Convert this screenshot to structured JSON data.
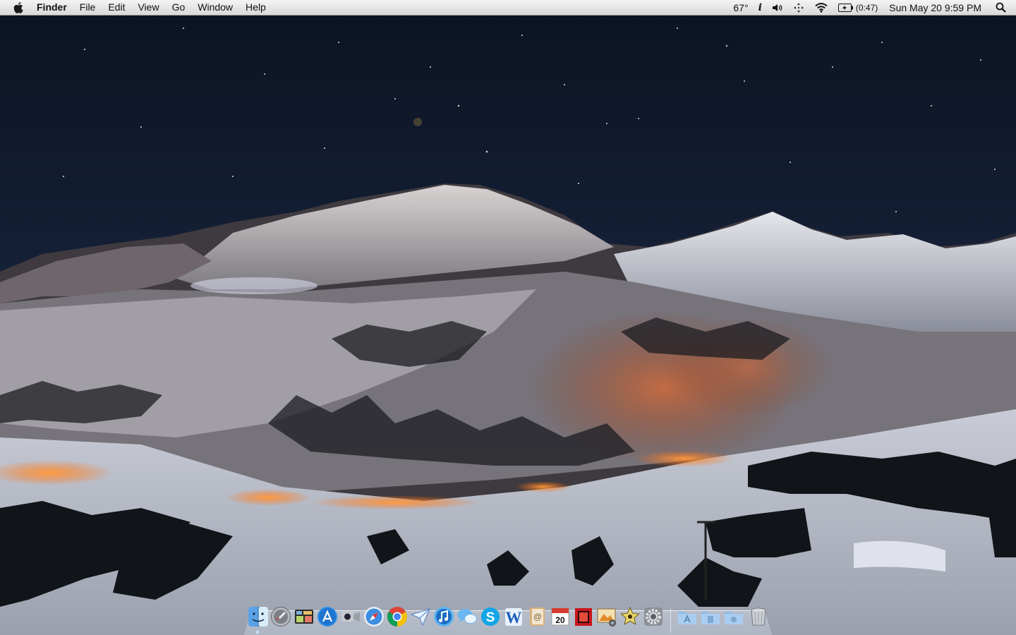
{
  "menubar": {
    "apple_icon": "apple-logo-icon",
    "app_name": "Finder",
    "menus": [
      "File",
      "Edit",
      "View",
      "Go",
      "Window",
      "Help"
    ],
    "weather": "67°",
    "info_icon": "i",
    "volume_icon": "speaker-icon",
    "bluetooth_icon": "move-arrows-icon",
    "wifi_icon": "wifi-icon",
    "battery_icon": "battery-charging-icon",
    "battery_time": "(0:47)",
    "datetime": "Sun May 20  9:59 PM",
    "spotlight_icon": "magnifier-icon"
  },
  "dock": {
    "apps": [
      {
        "name": "Finder",
        "icon": "finder-icon"
      },
      {
        "name": "Launchpad",
        "icon": "rocket-icon"
      },
      {
        "name": "Mission Control",
        "icon": "mission-control-icon"
      },
      {
        "name": "App Store",
        "icon": "app-store-icon"
      },
      {
        "name": "FaceTime",
        "icon": "camera-icon"
      },
      {
        "name": "Safari",
        "icon": "compass-icon"
      },
      {
        "name": "Chrome",
        "icon": "chrome-icon"
      },
      {
        "name": "Sparrow",
        "icon": "paper-plane-icon"
      },
      {
        "name": "iTunes",
        "icon": "music-note-icon"
      },
      {
        "name": "Messages",
        "icon": "chat-bubbles-icon"
      },
      {
        "name": "Skype",
        "icon": "skype-icon"
      },
      {
        "name": "Word",
        "icon": "word-icon"
      },
      {
        "name": "Address Book",
        "icon": "address-book-icon"
      },
      {
        "name": "Calendar",
        "icon": "calendar-icon",
        "label": "20"
      },
      {
        "name": "Photo Booth",
        "icon": "photo-booth-icon"
      },
      {
        "name": "iPhoto",
        "icon": "photos-icon"
      },
      {
        "name": "Starred",
        "icon": "star-icon"
      },
      {
        "name": "System Preferences",
        "icon": "gears-icon"
      }
    ],
    "stacks": [
      {
        "name": "Applications",
        "icon": "applications-folder-icon"
      },
      {
        "name": "Documents",
        "icon": "documents-folder-icon"
      },
      {
        "name": "Downloads",
        "icon": "downloads-folder-icon"
      },
      {
        "name": "Trash",
        "icon": "trash-icon"
      }
    ]
  }
}
